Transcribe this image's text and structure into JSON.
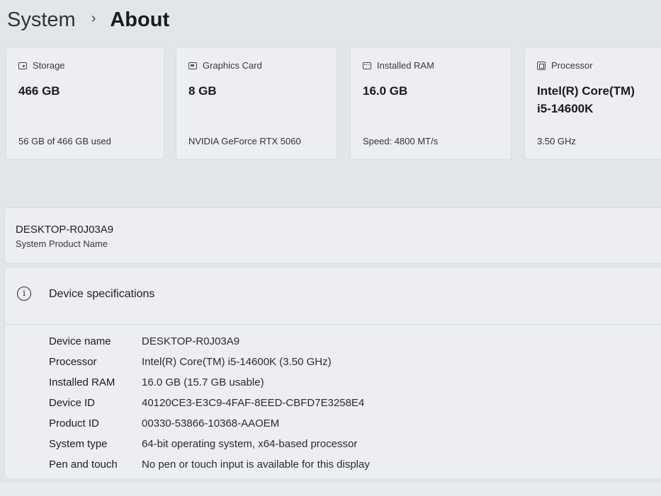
{
  "breadcrumb": {
    "parent": "System",
    "separator": "›",
    "current": "About"
  },
  "cards": [
    {
      "icon": "storage-icon",
      "title": "Storage",
      "value": "466 GB",
      "footer": "56 GB of 466 GB used"
    },
    {
      "icon": "graphics-card-icon",
      "title": "Graphics Card",
      "value": "8 GB",
      "footer": "NVIDIA GeForce RTX 5060"
    },
    {
      "icon": "ram-icon",
      "title": "Installed RAM",
      "value": "16.0 GB",
      "footer": "Speed: 4800 MT/s"
    },
    {
      "icon": "processor-icon",
      "title": "Processor",
      "value_line1": "Intel(R) Core(TM)",
      "value_line2": "i5-14600K",
      "footer": "3.50 GHz"
    }
  ],
  "product": {
    "name": "DESKTOP-R0J03A9",
    "label": "System Product Name"
  },
  "specs": {
    "icon": "info-icon",
    "title": "Device specifications",
    "rows": [
      {
        "key": "Device name",
        "value": "DESKTOP-R0J03A9"
      },
      {
        "key": "Processor",
        "value": "Intel(R) Core(TM) i5-14600K (3.50 GHz)"
      },
      {
        "key": "Installed RAM",
        "value": "16.0 GB (15.7 GB usable)"
      },
      {
        "key": "Device ID",
        "value": "40120CE3-E3C9-4FAF-8EED-CBFD7E3258E4"
      },
      {
        "key": "Product ID",
        "value": "00330-53866-10368-AAOEM"
      },
      {
        "key": "System type",
        "value": "64-bit operating system, x64-based processor"
      },
      {
        "key": "Pen and touch",
        "value": "No pen or touch input is available for this display"
      }
    ]
  }
}
